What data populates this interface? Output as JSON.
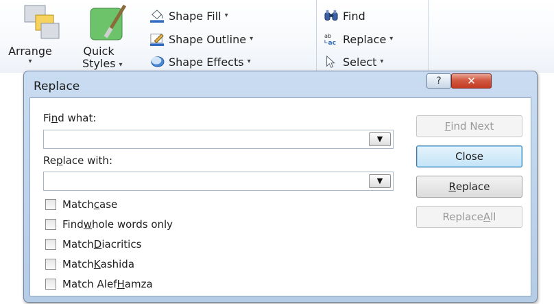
{
  "ribbon": {
    "arrange_label": "Arrange",
    "quick_styles_top": "Quick",
    "quick_styles_bottom": "Styles",
    "shape_fill": "Shape Fill",
    "shape_outline": "Shape Outline",
    "shape_effects": "Shape Effects",
    "find": "Find",
    "replace": "Replace",
    "select": "Select",
    "dropdown_glyph": "▾"
  },
  "dialog": {
    "title": "Replace",
    "help_glyph": "?",
    "close_glyph": "✕",
    "find_what_pre": "Fi",
    "find_what_key": "n",
    "find_what_post": "d what:",
    "find_what_value": "",
    "replace_with_pre": "Re",
    "replace_with_key": "p",
    "replace_with_post": "lace with:",
    "replace_with_value": "",
    "combo_arrow": "▼",
    "checkboxes": [
      {
        "pre": "Match ",
        "key": "c",
        "post": "ase",
        "checked": false
      },
      {
        "pre": "Find ",
        "key": "w",
        "post": "hole words only",
        "checked": false
      },
      {
        "pre": "Match ",
        "key": "D",
        "post": "iacritics",
        "checked": false
      },
      {
        "pre": "Match ",
        "key": "K",
        "post": "ashida",
        "checked": false
      },
      {
        "pre": "Match Alef ",
        "key": "H",
        "post": "amza",
        "checked": false
      }
    ],
    "buttons": {
      "find_next_key": "F",
      "find_next_post": "ind Next",
      "close": "Close",
      "replace_key": "R",
      "replace_post": "eplace",
      "replace_all_pre": "Replace ",
      "replace_all_key": "A",
      "replace_all_post": "ll"
    }
  },
  "colors": {
    "dialog_frame": "#b5cce7",
    "close_button": "#c43b22",
    "default_button": "#c4e4f7"
  }
}
